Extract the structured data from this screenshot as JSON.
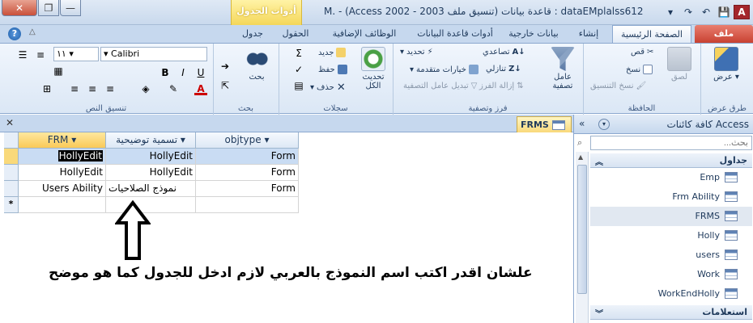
{
  "window": {
    "title": "M. - (Access 2002 - 2003 قاعدة بيانات (تنسيق ملف : dataEMplalss612",
    "context_tab": "أدوات الجدول",
    "close_glyph": "✕",
    "max_glyph": "❐",
    "min_glyph": "—"
  },
  "qat": {
    "app_icon": "A",
    "save": "💾",
    "undo": "↶",
    "redo": "↷",
    "dropdown": "▾"
  },
  "tabs": {
    "file": "ملف",
    "home": "الصفحة الرئيسية",
    "create": "إنشاء",
    "external": "بيانات خارجية",
    "db_tools": "أدوات قاعدة البيانات",
    "addins": "الوظائف الإضافية",
    "fields": "الحقول",
    "table": "جدول"
  },
  "ribbon": {
    "views": {
      "label": "عرض",
      "group": "طرق عرض"
    },
    "clipboard": {
      "paste": "لصق",
      "cut": "قص",
      "copy": "نسخ",
      "format_painter": "نسخ التنسيق",
      "group": "الحافظة"
    },
    "sort_filter": {
      "filter": "عامل تصفية",
      "ascending": "تصاعدي",
      "descending": "تنازلي",
      "remove_sort": "إزالة الفرز",
      "selection": "تحديد",
      "advanced": "خيارات متقدمة",
      "toggle_filter": "تبديل عامل التصفية",
      "group": "فرز وتصفية"
    },
    "records": {
      "refresh": "تحديث الكل",
      "new": "جديد",
      "save": "حفظ",
      "delete": "حذف",
      "group": "سجلات"
    },
    "find": {
      "find": "بحث",
      "group": "بحث"
    },
    "text_format": {
      "font": "Calibri",
      "size": "١١",
      "group": "تنسيق النص"
    }
  },
  "doc": {
    "tab": "FRMS",
    "columns": [
      "FRM",
      "تسمية توضيحية",
      "objtype"
    ],
    "rows": [
      [
        "HollyEdit",
        "HollyEdit",
        "Form"
      ],
      [
        "HollyEdit",
        "HollyEdit",
        "Form"
      ],
      [
        "Users Ability",
        "نموذج الصلاحيات",
        "Form"
      ]
    ],
    "new_row_marker": "*"
  },
  "caption": "علشان اقدر اكتب اسم النموذج بالعربي لازم ادخل للجدول كما هو موضح",
  "nav": {
    "title": "كافة كائنات Access",
    "search_placeholder": "بحث...",
    "groups": {
      "tables": "جداول",
      "queries": "استعلامات"
    },
    "items": [
      "Emp",
      "Frm Ability",
      "FRMS",
      "Holly",
      "users",
      "Work",
      "WorkEndHolly"
    ]
  },
  "colors": {
    "accent": "#1e395b",
    "file_tab": "#c84132",
    "context_tab": "#f4d75a",
    "selected_row": "#c9dcf3"
  }
}
